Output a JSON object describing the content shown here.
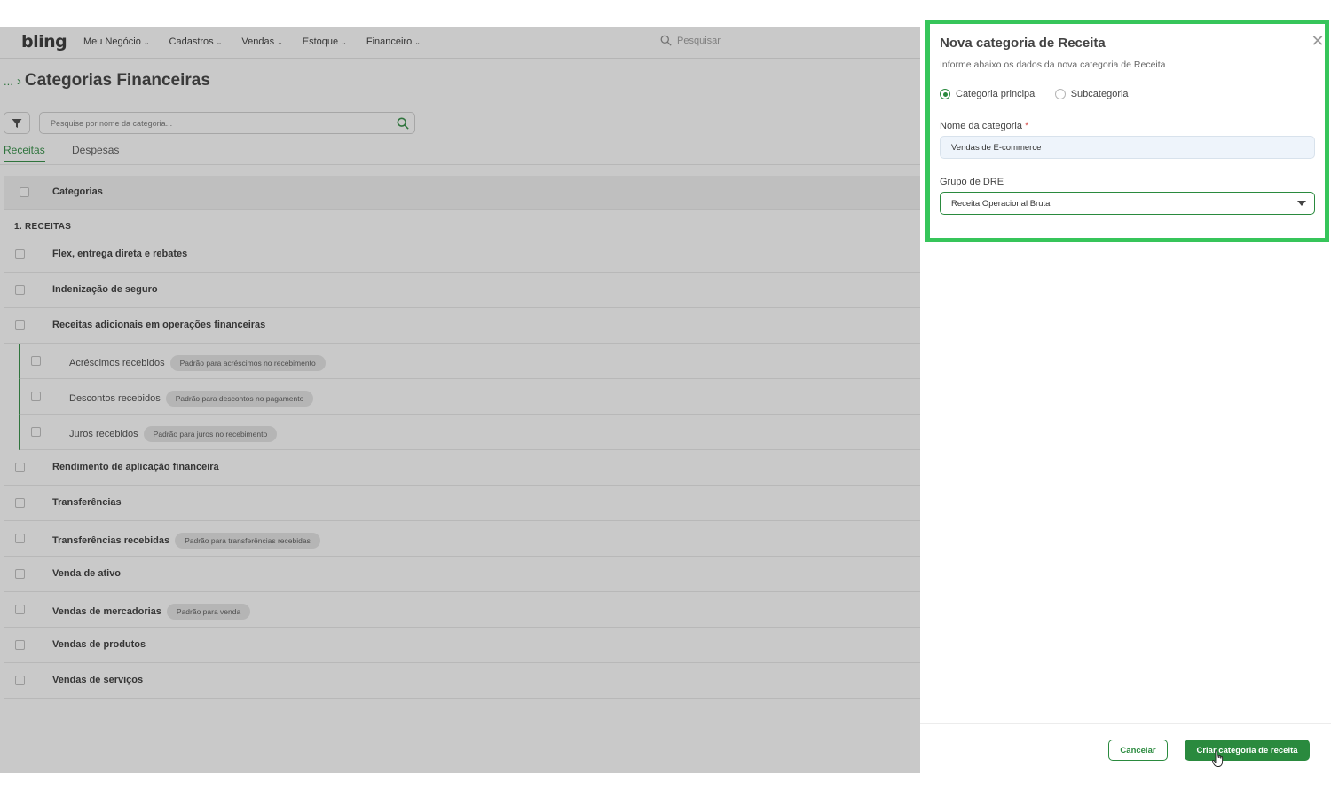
{
  "topbar": {
    "logo": "bling",
    "menu": [
      {
        "label": "Meu Negócio"
      },
      {
        "label": "Cadastros"
      },
      {
        "label": "Vendas"
      },
      {
        "label": "Estoque"
      },
      {
        "label": "Financeiro"
      }
    ],
    "search_placeholder": "Pesquisar"
  },
  "breadcrumb": {
    "dots": "...",
    "sep": "›",
    "title": "Categorias Financeiras"
  },
  "filter": {
    "search_placeholder": "Pesquise por nome da categoria..."
  },
  "tabs": [
    {
      "label": "Receitas",
      "active": true
    },
    {
      "label": "Despesas",
      "active": false
    }
  ],
  "table": {
    "header": "Categorias",
    "group": "1. RECEITAS",
    "rows": [
      {
        "name": "Flex, entrega direta e rebates",
        "badge": "",
        "sub": false
      },
      {
        "name": "Indenização de seguro",
        "badge": "",
        "sub": false
      },
      {
        "name": "Receitas adicionais em operações financeiras",
        "badge": "",
        "sub": false
      },
      {
        "name": "Acréscimos recebidos",
        "badge": "Padrão para acréscimos no recebimento",
        "sub": true
      },
      {
        "name": "Descontos recebidos",
        "badge": "Padrão para descontos no pagamento",
        "sub": true
      },
      {
        "name": "Juros recebidos",
        "badge": "Padrão para juros no recebimento",
        "sub": true
      },
      {
        "name": "Rendimento de aplicação financeira",
        "badge": "",
        "sub": false
      },
      {
        "name": "Transferências",
        "badge": "",
        "sub": false
      },
      {
        "name": "Transferências recebidas",
        "badge": "Padrão para transferências recebidas",
        "sub": false
      },
      {
        "name": "Venda de ativo",
        "badge": "",
        "sub": false
      },
      {
        "name": "Vendas de mercadorias",
        "badge": "Padrão para venda",
        "sub": false
      },
      {
        "name": "Vendas de produtos",
        "badge": "",
        "sub": false
      },
      {
        "name": "Vendas de serviços",
        "badge": "",
        "sub": false
      }
    ]
  },
  "panel": {
    "title": "Nova categoria de Receita",
    "subtitle": "Informe abaixo os dados da nova categoria de Receita",
    "radio_main": "Categoria principal",
    "radio_sub": "Subcategoria",
    "name_label": "Nome da categoria",
    "required_mark": "*",
    "name_value": "Vendas de E-commerce",
    "dre_label": "Grupo de DRE",
    "dre_value": "Receita Operacional Bruta",
    "cancel_label": "Cancelar",
    "create_label": "Criar categoria de receita",
    "close_glyph": "✕"
  },
  "colors": {
    "accent": "#2a8a3e",
    "highlight": "#36c55a"
  }
}
